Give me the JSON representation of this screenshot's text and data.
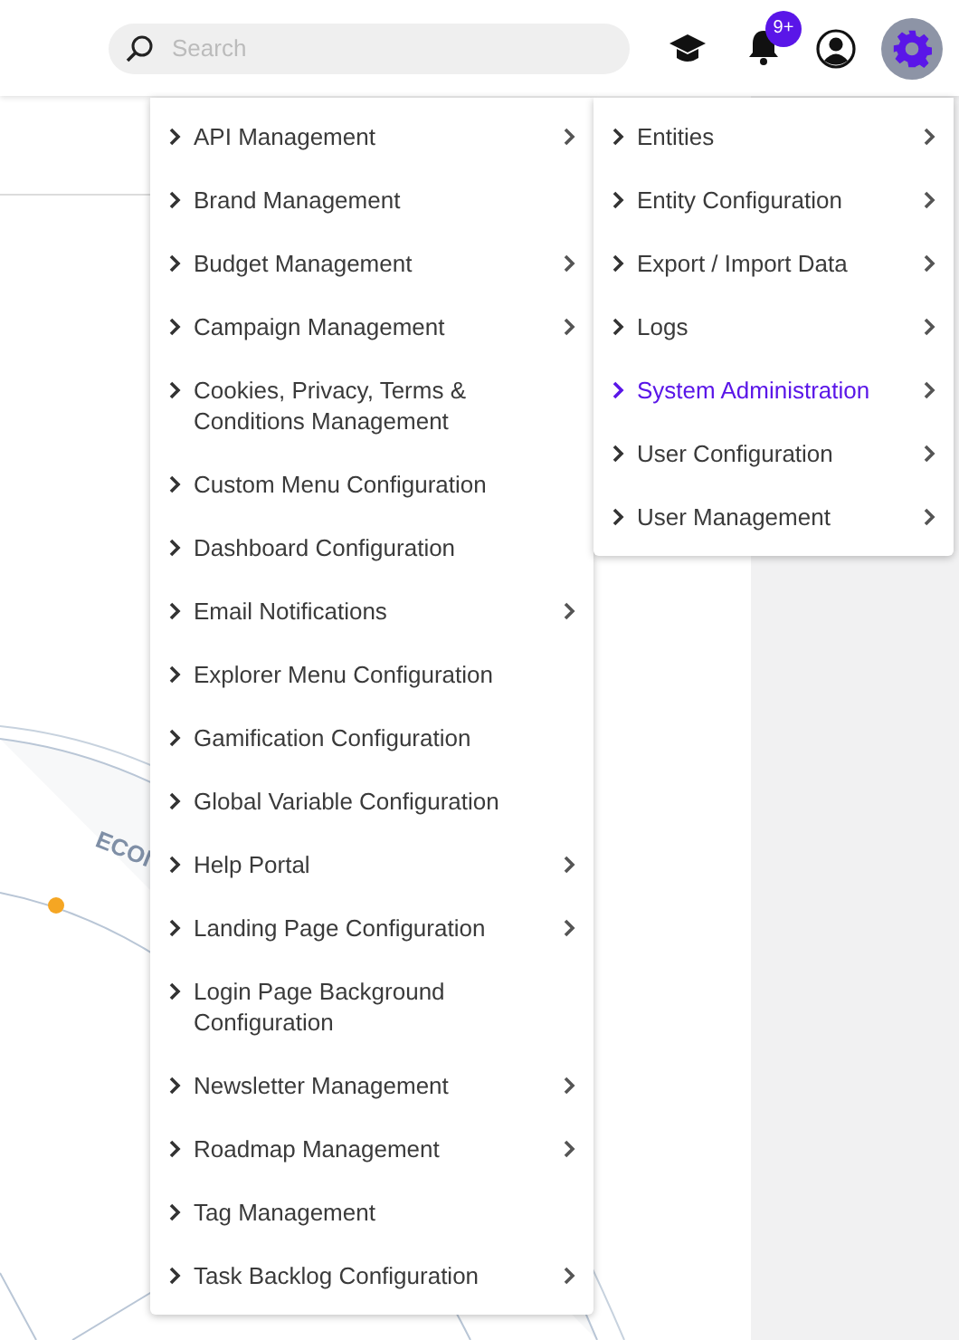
{
  "search": {
    "placeholder": "Search"
  },
  "notifications": {
    "badge": "9+"
  },
  "settings_button": {
    "selected": true
  },
  "background": {
    "diagram_label": "ECOI"
  },
  "menu": {
    "items": [
      {
        "label": "API Management",
        "has_submenu": true,
        "selected": false
      },
      {
        "label": "Brand Management",
        "has_submenu": false,
        "selected": false
      },
      {
        "label": "Budget Management",
        "has_submenu": true,
        "selected": false
      },
      {
        "label": "Campaign Management",
        "has_submenu": true,
        "selected": false
      },
      {
        "label": "Cookies, Privacy, Terms & Conditions Management",
        "has_submenu": false,
        "selected": false
      },
      {
        "label": "Custom Menu Configuration",
        "has_submenu": false,
        "selected": false
      },
      {
        "label": "Dashboard Configuration",
        "has_submenu": false,
        "selected": false
      },
      {
        "label": "Email Notifications",
        "has_submenu": true,
        "selected": false
      },
      {
        "label": "Explorer Menu Configuration",
        "has_submenu": false,
        "selected": false
      },
      {
        "label": "Gamification Configuration",
        "has_submenu": false,
        "selected": false
      },
      {
        "label": "Global Variable Configuration",
        "has_submenu": false,
        "selected": false
      },
      {
        "label": "Help Portal",
        "has_submenu": true,
        "selected": false
      },
      {
        "label": "Landing Page Configuration",
        "has_submenu": true,
        "selected": false
      },
      {
        "label": "Login Page Background Configuration",
        "has_submenu": false,
        "selected": false
      },
      {
        "label": "Newsletter Management",
        "has_submenu": true,
        "selected": false
      },
      {
        "label": "Roadmap Management",
        "has_submenu": true,
        "selected": false
      },
      {
        "label": "Tag Management",
        "has_submenu": false,
        "selected": false
      },
      {
        "label": "Task Backlog Configuration",
        "has_submenu": true,
        "selected": false
      }
    ]
  },
  "submenu": {
    "items": [
      {
        "label": "Entities",
        "has_submenu": true,
        "selected": false
      },
      {
        "label": "Entity Configuration",
        "has_submenu": true,
        "selected": false
      },
      {
        "label": "Export / Import Data",
        "has_submenu": true,
        "selected": false
      },
      {
        "label": "Logs",
        "has_submenu": true,
        "selected": false
      },
      {
        "label": "System Administration",
        "has_submenu": true,
        "selected": true
      },
      {
        "label": "User Configuration",
        "has_submenu": true,
        "selected": false
      },
      {
        "label": "User Management",
        "has_submenu": true,
        "selected": false
      }
    ]
  }
}
